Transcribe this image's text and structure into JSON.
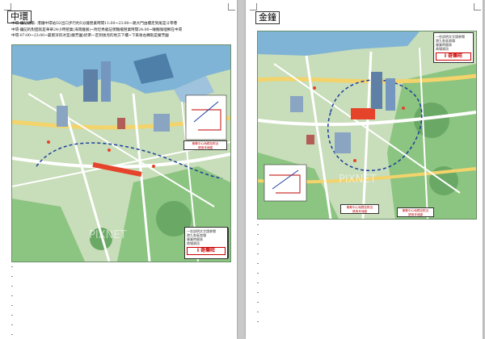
{
  "left_page": {
    "heading": "中環",
    "notes": [
      "中環-鏞記酒家: 港鐵中環站D2出口步行約5分鐘營業時間11:00~23:00一路大門由樓走到尾是斗零巷",
      "中環-鏞記的對面就是華華24小時營業(海南雞飯)~附近秀龍記粥麵檔營業時間24:00~睡麵咖哩鮮在中環",
      "中環-07:00~23:00~最資深的冰室(蘭芳園)奶茶一定到後兇的地方下樓~下來後右轉就是蘭芳園"
    ],
    "brand": {
      "lines": [
        "一些說明文字請參閱",
        "港九各區商場",
        "營業時間表",
        "商場資訊"
      ],
      "logo": "I 奇樂旺"
    },
    "hint": {
      "lines": [
        "聯繫中心地鐵站附近",
        "請用本地圖"
      ]
    }
  },
  "right_page": {
    "heading": "金鐘",
    "brand": {
      "lines": [
        "一些說明文字請參閱",
        "港九各區商場",
        "營業時間表",
        "商場資訊"
      ],
      "logo": "I 奇樂旺"
    },
    "hint": {
      "lines": [
        "聯繫中心地鐵站附近",
        "請用本地圖"
      ]
    },
    "hint2": {
      "lines": [
        "聯繫中心地鐵站附近",
        "請用本地圖"
      ]
    }
  },
  "watermark": "PIXNET",
  "colors": {
    "sea": "#7fb4d6",
    "park": "#8cc481",
    "land": "#c8ddb9",
    "road": "#ffffff",
    "main_road": "#f3d36b",
    "route": "#1b3fa0",
    "highlight": "#e6432b"
  }
}
